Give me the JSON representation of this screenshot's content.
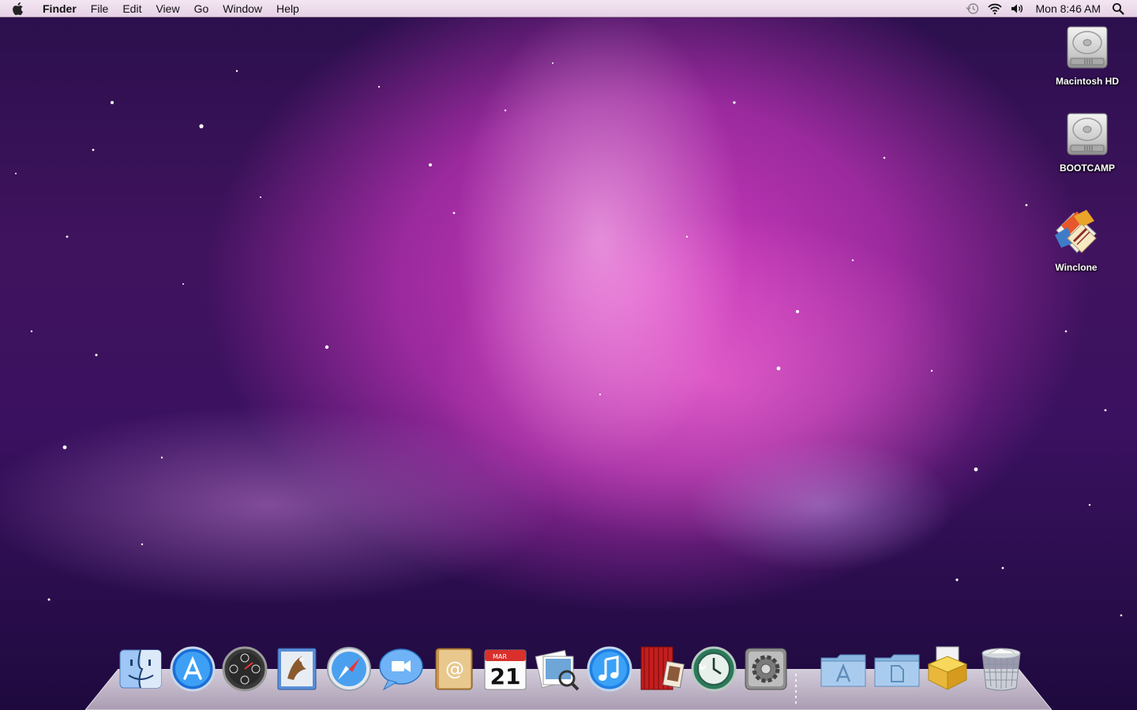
{
  "menubar": {
    "app_name": "Finder",
    "menus": [
      "File",
      "Edit",
      "View",
      "Go",
      "Window",
      "Help"
    ],
    "clock": "Mon 8:46 AM"
  },
  "desktop_icons": [
    {
      "label": "Macintosh HD",
      "icon": "hard-drive-icon"
    },
    {
      "label": "BOOTCAMP",
      "icon": "hard-drive-icon"
    },
    {
      "label": "Winclone",
      "icon": "winclone-app-icon"
    }
  ],
  "dock": {
    "apps": [
      "finder-icon",
      "app-store-icon",
      "dashboard-icon",
      "mail-icon",
      "safari-icon",
      "ichat-icon",
      "address-book-icon",
      "ical-icon",
      "preview-icon",
      "itunes-icon",
      "front-row-icon",
      "time-machine-icon",
      "system-preferences-icon"
    ],
    "calendar": {
      "month": "MAR",
      "day": "21"
    },
    "stacks": [
      "applications-folder-icon",
      "documents-folder-icon",
      "downloads-stack-icon",
      "trash-icon"
    ]
  },
  "colors": {
    "menubar_bg": "#e9d7e9",
    "wallpaper_primary": "#c934b8",
    "wallpaper_dark": "#2a0f4c"
  }
}
